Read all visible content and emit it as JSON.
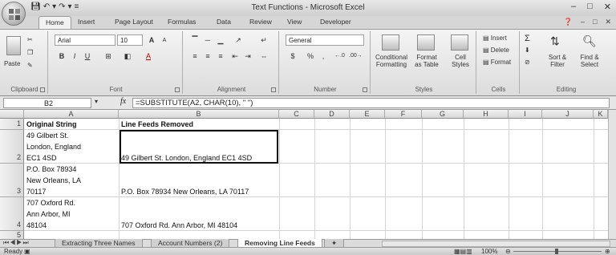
{
  "window": {
    "title": "Text Functions - Microsoft Excel",
    "qat": [
      "save-icon",
      "undo-icon",
      "redo-icon"
    ],
    "controls": [
      "minimize-icon",
      "restore-icon",
      "close-icon"
    ]
  },
  "ribbon_tabs": [
    "Home",
    "Insert",
    "Page Layout",
    "Formulas",
    "Data",
    "Review",
    "View",
    "Developer"
  ],
  "active_tab": "Home",
  "ribbon": {
    "clipboard": {
      "label": "Clipboard",
      "paste": "Paste"
    },
    "font": {
      "label": "Font",
      "name": "Arial",
      "size": "10",
      "bold": "B",
      "italic": "I",
      "underline": "U",
      "grow": "A",
      "shrink": "A"
    },
    "alignment": {
      "label": "Alignment"
    },
    "number": {
      "label": "Number",
      "format": "General",
      "currency": "$",
      "percent": "%",
      "comma": ","
    },
    "styles": {
      "label": "Styles",
      "conditional": "Conditional",
      "conditional2": "Formatting",
      "format_as": "Format",
      "format_as2": "as Table",
      "cell_styles": "Cell",
      "cell_styles2": "Styles"
    },
    "cells": {
      "label": "Cells",
      "insert": "Insert",
      "delete": "Delete",
      "format": "Format"
    },
    "editing": {
      "label": "Editing",
      "sort": "Sort &",
      "sort2": "Filter",
      "find": "Find &",
      "find2": "Select"
    }
  },
  "formula_bar": {
    "cell_ref": "B2",
    "fx": "fx",
    "formula": "=SUBSTITUTE(A2, CHAR(10), \" \")"
  },
  "columns": [
    "A",
    "B",
    "C",
    "D",
    "E",
    "F",
    "G",
    "H",
    "I",
    "J",
    "K"
  ],
  "rows": [
    {
      "num": "1",
      "a": [
        "Original String"
      ],
      "b": "Line Feeds Removed",
      "header": true
    },
    {
      "num": "2",
      "a": [
        "49 Gilbert St.",
        "London, England",
        "EC1 4SD"
      ],
      "b": "49 Gilbert St. London, England EC1 4SD"
    },
    {
      "num": "3",
      "a": [
        "P.O. Box 78934",
        "New Orleans, LA",
        "70117"
      ],
      "b": "P.O. Box 78934 New Orleans, LA 70117"
    },
    {
      "num": "4",
      "a": [
        "707 Oxford Rd.",
        "Ann Arbor, MI",
        "48104"
      ],
      "b": "707 Oxford Rd. Ann Arbor, MI 48104"
    },
    {
      "num": "5",
      "a": [],
      "b": ""
    }
  ],
  "sheet_tabs": [
    "Extracting Three Names",
    "Account Numbers (2)",
    "Removing Line Feeds"
  ],
  "active_sheet": "Removing Line Feeds",
  "status": {
    "ready": "Ready",
    "zoom": "100%"
  }
}
